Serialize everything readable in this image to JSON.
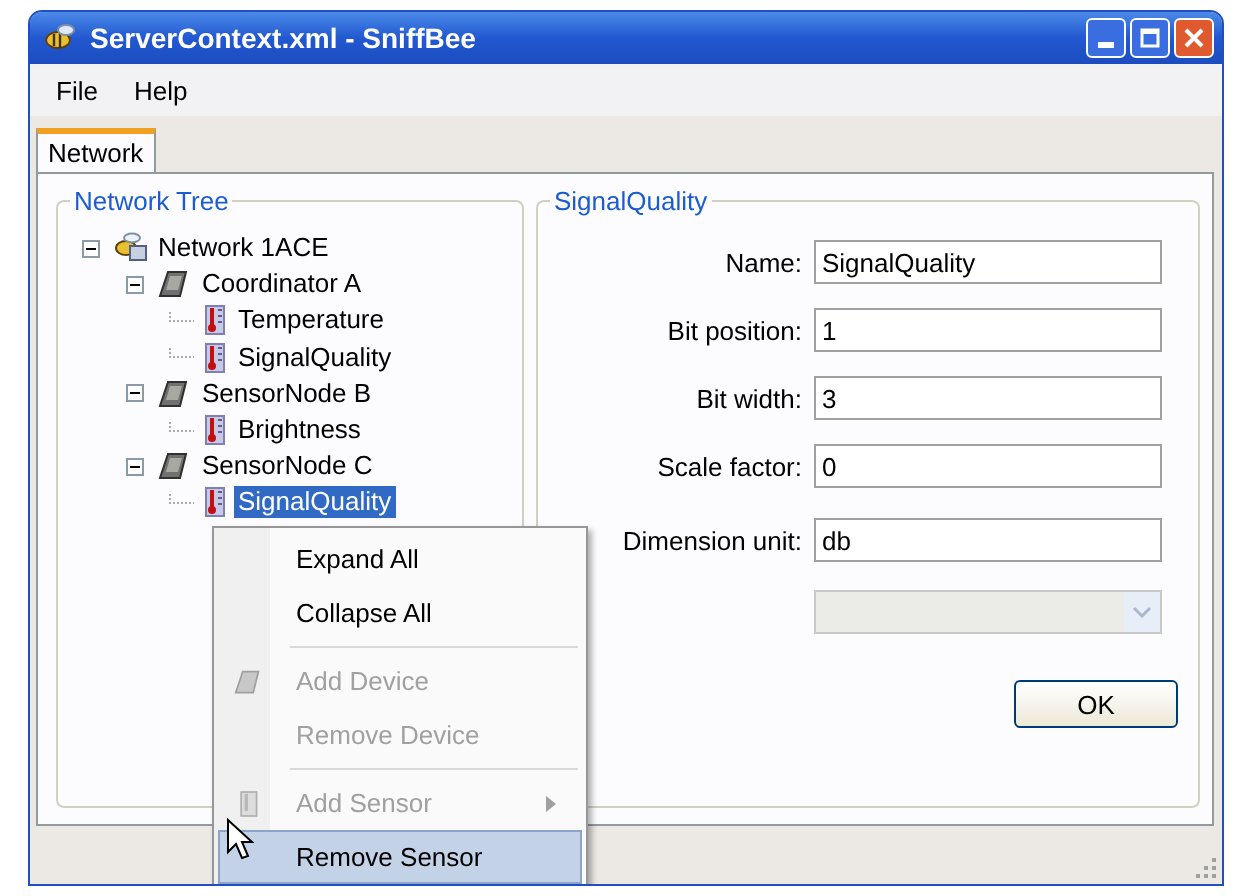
{
  "window": {
    "title": "ServerContext.xml - SniffBee"
  },
  "menu": [
    "File",
    "Help"
  ],
  "tabs": [
    {
      "label": "Network",
      "selected": true
    }
  ],
  "tree_panel": {
    "title": "Network Tree",
    "nodes": [
      {
        "label": "Network 1ACE",
        "kind": "network",
        "expanded": true,
        "selected": false,
        "children": [
          {
            "label": "Coordinator A",
            "kind": "device",
            "expanded": true,
            "selected": false,
            "children": [
              {
                "label": "Temperature",
                "kind": "sensor",
                "selected": false
              },
              {
                "label": "SignalQuality",
                "kind": "sensor",
                "selected": false
              }
            ]
          },
          {
            "label": "SensorNode B",
            "kind": "device",
            "expanded": true,
            "selected": false,
            "children": [
              {
                "label": "Brightness",
                "kind": "sensor",
                "selected": false
              }
            ]
          },
          {
            "label": "SensorNode C",
            "kind": "device",
            "expanded": true,
            "selected": false,
            "children": [
              {
                "label": "SignalQuality",
                "kind": "sensor",
                "selected": true
              }
            ]
          }
        ]
      }
    ]
  },
  "detail_panel": {
    "title": "SignalQuality",
    "fields": [
      {
        "label": "Name:",
        "value": "SignalQuality"
      },
      {
        "label": "Bit position:",
        "value": "1"
      },
      {
        "label": "Bit width:",
        "value": "3"
      },
      {
        "label": "Scale factor:",
        "value": "0"
      },
      {
        "label": "Dimension unit:",
        "value": "db"
      }
    ],
    "dropdown": {
      "disabled": true
    },
    "ok_button": "OK"
  },
  "context_menu": [
    {
      "kind": "item",
      "label": "Expand All",
      "disabled": false,
      "selected": false,
      "submenu": false
    },
    {
      "kind": "item",
      "label": "Collapse All",
      "disabled": false,
      "selected": false,
      "submenu": false
    },
    {
      "kind": "separator"
    },
    {
      "kind": "device_item",
      "label": "Add Device",
      "disabled": true,
      "selected": false,
      "submenu": false
    },
    {
      "kind": "item",
      "label": "Remove Device",
      "disabled": true,
      "selected": false,
      "submenu": false
    },
    {
      "kind": "separator"
    },
    {
      "kind": "sensor_item",
      "label": "Add Sensor",
      "disabled": true,
      "selected": false,
      "submenu": true
    },
    {
      "kind": "item",
      "label": "Remove Sensor",
      "disabled": false,
      "selected": true,
      "submenu": false
    }
  ]
}
